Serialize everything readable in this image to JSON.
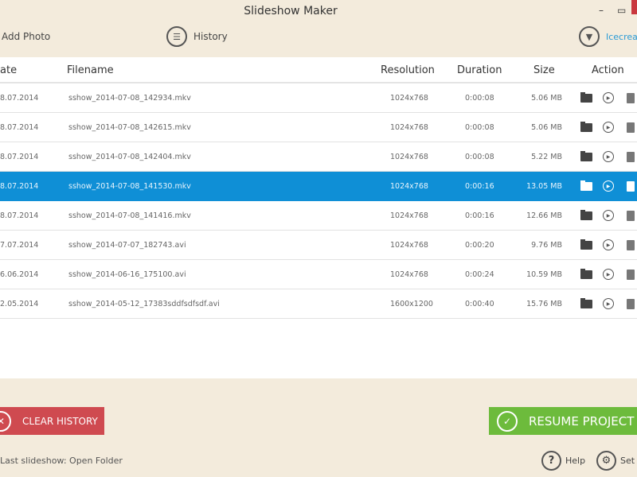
{
  "window": {
    "title": "Slideshow Maker",
    "minimize": "–",
    "maximize": "▭"
  },
  "toolbar": {
    "add_photo": "Add Photo",
    "history": "History",
    "brand": "Icecream"
  },
  "table": {
    "headers": {
      "date": "ate",
      "filename": "Filename",
      "resolution": "Resolution",
      "duration": "Duration",
      "size": "Size",
      "action": "Action"
    },
    "rows": [
      {
        "date": "8.07.2014",
        "filename": "sshow_2014-07-08_142934.mkv",
        "resolution": "1024x768",
        "duration": "0:00:08",
        "size": "5.06 MB"
      },
      {
        "date": "8.07.2014",
        "filename": "sshow_2014-07-08_142615.mkv",
        "resolution": "1024x768",
        "duration": "0:00:08",
        "size": "5.06 MB"
      },
      {
        "date": "8.07.2014",
        "filename": "sshow_2014-07-08_142404.mkv",
        "resolution": "1024x768",
        "duration": "0:00:08",
        "size": "5.22 MB"
      },
      {
        "date": "8.07.2014",
        "filename": "sshow_2014-07-08_141530.mkv",
        "resolution": "1024x768",
        "duration": "0:00:16",
        "size": "13.05 MB",
        "selected": true
      },
      {
        "date": "8.07.2014",
        "filename": "sshow_2014-07-08_141416.mkv",
        "resolution": "1024x768",
        "duration": "0:00:16",
        "size": "12.66 MB"
      },
      {
        "date": "7.07.2014",
        "filename": "sshow_2014-07-07_182743.avi",
        "resolution": "1024x768",
        "duration": "0:00:20",
        "size": "9.76 MB"
      },
      {
        "date": "6.06.2014",
        "filename": "sshow_2014-06-16_175100.avi",
        "resolution": "1024x768",
        "duration": "0:00:24",
        "size": "10.59 MB"
      },
      {
        "date": "2.05.2014",
        "filename": "sshow_2014-05-12_17383sddfsdfsdf.avi",
        "resolution": "1600x1200",
        "duration": "0:00:40",
        "size": "15.76 MB"
      }
    ]
  },
  "footer": {
    "clear_history": "CLEAR HISTORY",
    "resume_project": "RESUME PROJECT",
    "last_slideshow": "Last slideshow: Open Folder",
    "help": "Help",
    "settings": "Set"
  },
  "colors": {
    "selected": "#0f8fd6",
    "clear": "#cf4a50",
    "resume": "#6dbb3c",
    "background": "#f3ebdc"
  }
}
